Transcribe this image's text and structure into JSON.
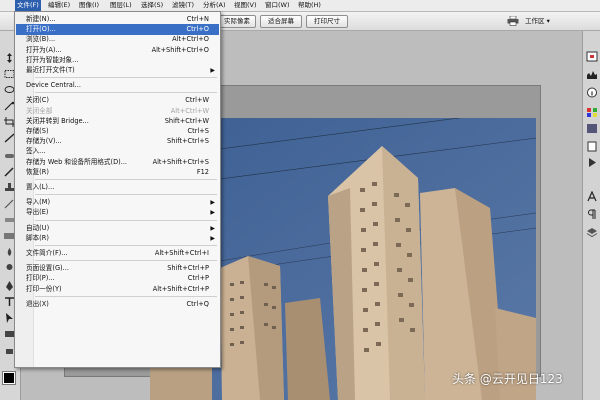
{
  "menubar": [
    {
      "label": "文件(F)",
      "active": true
    },
    {
      "label": "编辑(E)"
    },
    {
      "label": "图像(I)"
    },
    {
      "label": "图层(L)"
    },
    {
      "label": "选择(S)"
    },
    {
      "label": "滤镜(T)"
    },
    {
      "label": "分析(A)"
    },
    {
      "label": "视图(V)"
    },
    {
      "label": "窗口(W)"
    },
    {
      "label": "帮助(H)"
    }
  ],
  "options_bar": {
    "buttons": [
      "实际像素",
      "适合屏幕",
      "打印尺寸"
    ],
    "workspace_label": "工作区 ▾"
  },
  "file_menu": {
    "items": [
      {
        "type": "item",
        "label": "新建(N)...",
        "shortcut": "Ctrl+N"
      },
      {
        "type": "item",
        "label": "打开(O)...",
        "shortcut": "Ctrl+O",
        "highlighted": true
      },
      {
        "type": "item",
        "label": "浏览(B)...",
        "shortcut": "Alt+Ctrl+O"
      },
      {
        "type": "item",
        "label": "打开为(A)...",
        "shortcut": "Alt+Shift+Ctrl+O"
      },
      {
        "type": "item",
        "label": "打开为智能对象..."
      },
      {
        "type": "item",
        "label": "最近打开文件(T)",
        "submenu": true
      },
      {
        "type": "sep"
      },
      {
        "type": "item",
        "label": "Device Central..."
      },
      {
        "type": "sep"
      },
      {
        "type": "item",
        "label": "关闭(C)",
        "shortcut": "Ctrl+W"
      },
      {
        "type": "item",
        "label": "关闭全部",
        "shortcut": "Alt+Ctrl+W",
        "disabled": true
      },
      {
        "type": "item",
        "label": "关闭并转到 Bridge...",
        "shortcut": "Shift+Ctrl+W"
      },
      {
        "type": "item",
        "label": "存储(S)",
        "shortcut": "Ctrl+S"
      },
      {
        "type": "item",
        "label": "存储为(V)...",
        "shortcut": "Shift+Ctrl+S"
      },
      {
        "type": "item",
        "label": "签入..."
      },
      {
        "type": "item",
        "label": "存储为 Web 和设备所用格式(D)...",
        "shortcut": "Alt+Shift+Ctrl+S"
      },
      {
        "type": "item",
        "label": "恢复(R)",
        "shortcut": "F12"
      },
      {
        "type": "sep"
      },
      {
        "type": "item",
        "label": "置入(L)..."
      },
      {
        "type": "sep"
      },
      {
        "type": "item",
        "label": "导入(M)",
        "submenu": true
      },
      {
        "type": "item",
        "label": "导出(E)",
        "submenu": true
      },
      {
        "type": "sep"
      },
      {
        "type": "item",
        "label": "自动(U)",
        "submenu": true
      },
      {
        "type": "item",
        "label": "脚本(R)",
        "submenu": true
      },
      {
        "type": "sep"
      },
      {
        "type": "item",
        "label": "文件简介(F)...",
        "shortcut": "Alt+Shift+Ctrl+I"
      },
      {
        "type": "sep"
      },
      {
        "type": "item",
        "label": "页面设置(G)...",
        "shortcut": "Shift+Ctrl+P"
      },
      {
        "type": "item",
        "label": "打印(P)...",
        "shortcut": "Ctrl+P"
      },
      {
        "type": "item",
        "label": "打印一份(Y)",
        "shortcut": "Alt+Shift+Ctrl+P"
      },
      {
        "type": "sep"
      },
      {
        "type": "item",
        "label": "退出(X)",
        "shortcut": "Ctrl+Q"
      }
    ]
  },
  "watermark": "头条 @云开见日123",
  "colors": {
    "menu_highlight": "#3a6fc6",
    "menubar_active": "#2d5fae",
    "sky": "#4a6a98",
    "building": "#d8c3a6"
  }
}
